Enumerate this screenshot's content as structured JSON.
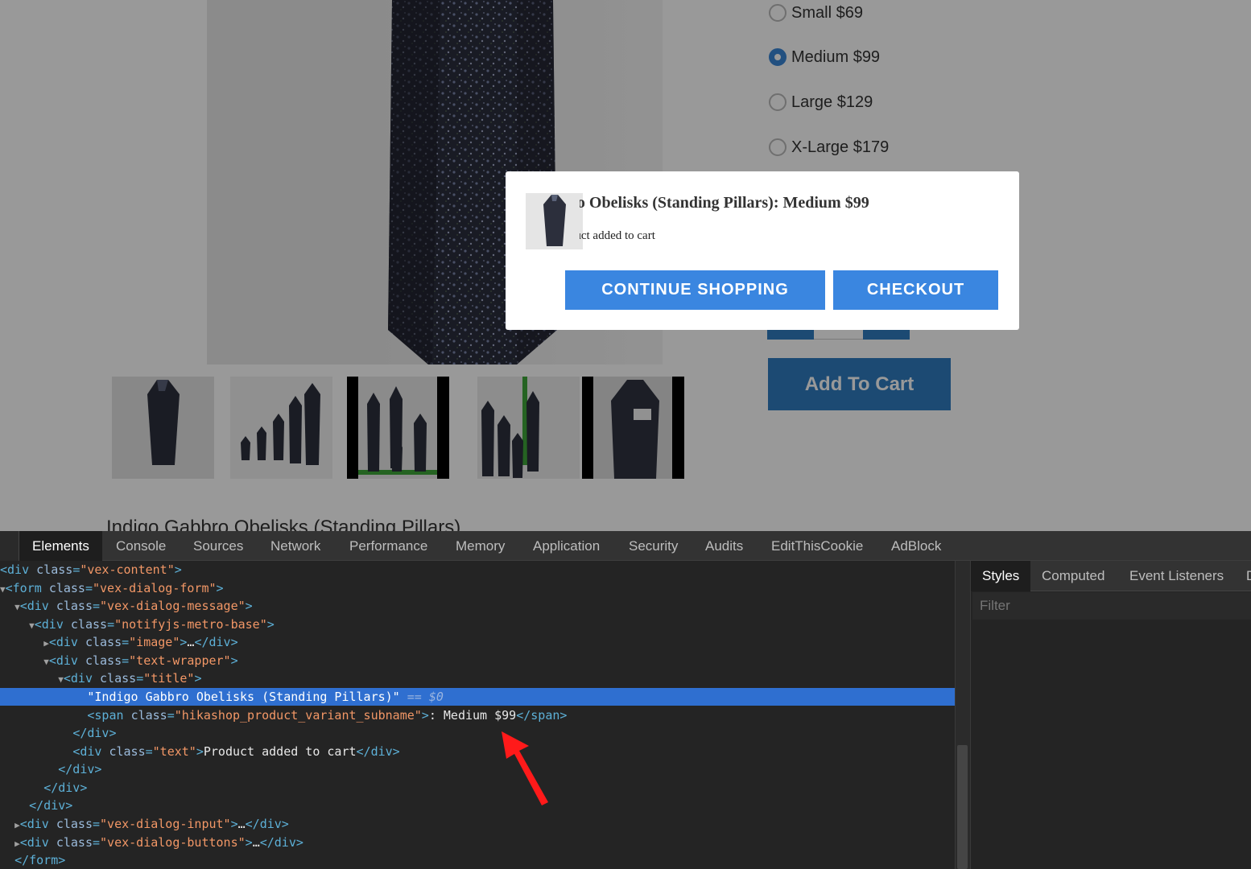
{
  "product": {
    "title": "Indigo Gabbro Obelisks (Standing Pillars)",
    "options": [
      {
        "label": "Small $69",
        "checked": false
      },
      {
        "label": "Medium $99",
        "checked": true
      },
      {
        "label": "Large $129",
        "checked": false
      },
      {
        "label": "X-Large $179",
        "checked": false
      }
    ],
    "add_to_cart_label": "Add To Cart"
  },
  "dialog": {
    "title": "Indigo Gabbro Obelisks (Standing Pillars): Medium $99",
    "message": "Product added to cart",
    "continue_label": "CONTINUE SHOPPING",
    "checkout_label": "CHECKOUT"
  },
  "devtools": {
    "tabs": [
      "Elements",
      "Console",
      "Sources",
      "Network",
      "Performance",
      "Memory",
      "Application",
      "Security",
      "Audits",
      "EditThisCookie",
      "AdBlock"
    ],
    "active_tab": "Elements",
    "side_tabs": [
      "Styles",
      "Computed",
      "Event Listeners",
      "D"
    ],
    "filter_placeholder": "Filter"
  },
  "colors": {
    "accent": "#3a86e0",
    "button_dark": "#2f7cc0",
    "selection": "#2f6fd0",
    "annotation_arrow": "#ff1a1a"
  },
  "icons": [
    "obelisk-product-image",
    "radio-icon",
    "expand-triangle-icon",
    "red-arrow-annotation"
  ]
}
